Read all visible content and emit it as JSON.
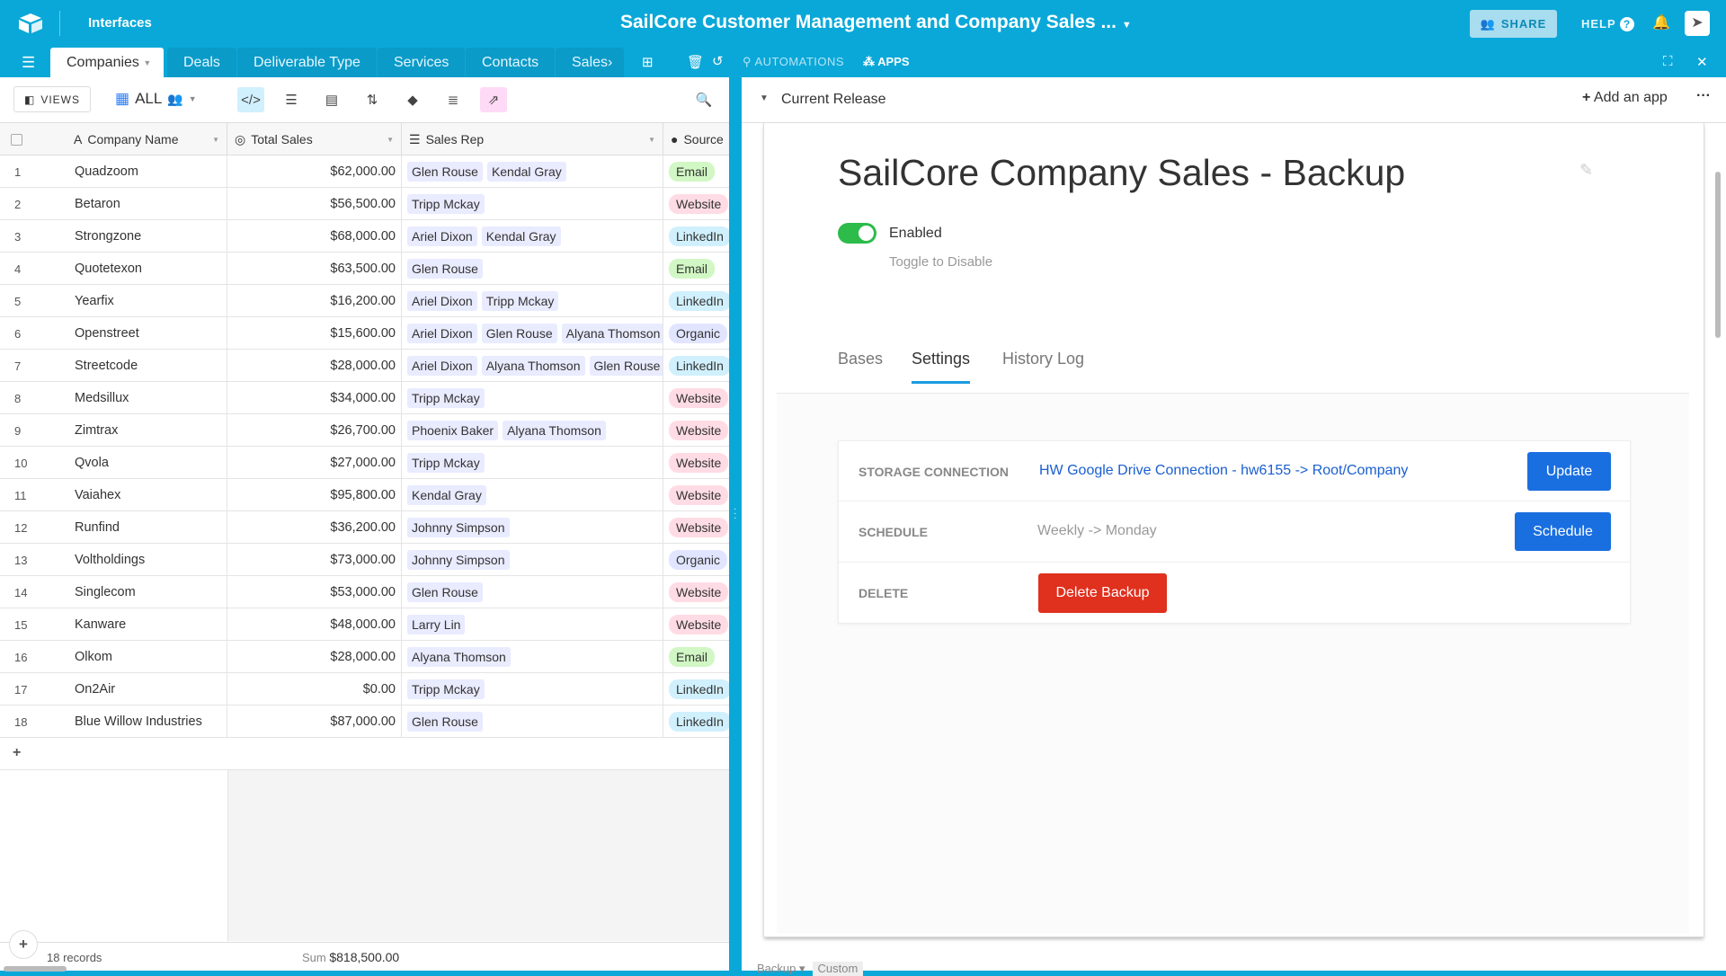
{
  "app": {
    "section": "Interfaces",
    "title": "SailCore Customer Management and Company Sales ...",
    "share": "SHARE",
    "help": "HELP"
  },
  "tabs": [
    "Companies",
    "Deals",
    "Deliverable Type",
    "Services",
    "Contacts",
    "Sales"
  ],
  "toolbar": {
    "automations": "AUTOMATIONS",
    "apps": "APPS",
    "views": "VIEWS",
    "view_name": "ALL"
  },
  "grid": {
    "columns": [
      "Company Name",
      "Total Sales",
      "Sales Rep",
      "Source"
    ],
    "rows": [
      {
        "n": "1",
        "name": "Quadzoom",
        "sales": "$62,000.00",
        "reps": [
          "Glen Rouse",
          "Kendal Gray"
        ],
        "source": "Email"
      },
      {
        "n": "2",
        "name": "Betaron",
        "sales": "$56,500.00",
        "reps": [
          "Tripp Mckay"
        ],
        "source": "Website"
      },
      {
        "n": "3",
        "name": "Strongzone",
        "sales": "$68,000.00",
        "reps": [
          "Ariel Dixon",
          "Kendal Gray"
        ],
        "source": "LinkedIn"
      },
      {
        "n": "4",
        "name": "Quotetexon",
        "sales": "$63,500.00",
        "reps": [
          "Glen Rouse"
        ],
        "source": "Email"
      },
      {
        "n": "5",
        "name": "Yearfix",
        "sales": "$16,200.00",
        "reps": [
          "Ariel Dixon",
          "Tripp Mckay"
        ],
        "source": "LinkedIn"
      },
      {
        "n": "6",
        "name": "Openstreet",
        "sales": "$15,600.00",
        "reps": [
          "Ariel Dixon",
          "Glen Rouse",
          "Alyana Thomson"
        ],
        "source": "Organic"
      },
      {
        "n": "7",
        "name": "Streetcode",
        "sales": "$28,000.00",
        "reps": [
          "Ariel Dixon",
          "Alyana Thomson",
          "Glen Rouse"
        ],
        "source": "LinkedIn"
      },
      {
        "n": "8",
        "name": "Medsillux",
        "sales": "$34,000.00",
        "reps": [
          "Tripp Mckay"
        ],
        "source": "Website"
      },
      {
        "n": "9",
        "name": "Zimtrax",
        "sales": "$26,700.00",
        "reps": [
          "Phoenix Baker",
          "Alyana Thomson"
        ],
        "source": "Website"
      },
      {
        "n": "10",
        "name": "Qvola",
        "sales": "$27,000.00",
        "reps": [
          "Tripp Mckay"
        ],
        "source": "Website"
      },
      {
        "n": "11",
        "name": "Vaiahex",
        "sales": "$95,800.00",
        "reps": [
          "Kendal Gray"
        ],
        "source": "Website"
      },
      {
        "n": "12",
        "name": "Runfind",
        "sales": "$36,200.00",
        "reps": [
          "Johnny Simpson"
        ],
        "source": "Website"
      },
      {
        "n": "13",
        "name": "Voltholdings",
        "sales": "$73,000.00",
        "reps": [
          "Johnny Simpson"
        ],
        "source": "Organic"
      },
      {
        "n": "14",
        "name": "Singlecom",
        "sales": "$53,000.00",
        "reps": [
          "Glen Rouse"
        ],
        "source": "Website"
      },
      {
        "n": "15",
        "name": "Kanware",
        "sales": "$48,000.00",
        "reps": [
          "Larry Lin"
        ],
        "source": "Website"
      },
      {
        "n": "16",
        "name": "Olkom",
        "sales": "$28,000.00",
        "reps": [
          "Alyana Thomson"
        ],
        "source": "Email"
      },
      {
        "n": "17",
        "name": "On2Air",
        "sales": "$0.00",
        "reps": [
          "Tripp Mckay"
        ],
        "source": "LinkedIn"
      },
      {
        "n": "18",
        "name": "Blue Willow Industries",
        "sales": "$87,000.00",
        "reps": [
          "Glen Rouse"
        ],
        "source": "LinkedIn"
      }
    ],
    "footer": {
      "records": "18 records",
      "sum_label": "Sum",
      "sum_value": "$818,500.00"
    }
  },
  "source_colors": {
    "Email": "#d1f7c4",
    "Website": "#ffdce5",
    "LinkedIn": "#d0f0fd",
    "Organic": "#e1e5ff"
  },
  "panel": {
    "header": "Current Release",
    "add_app": "Add an app",
    "title": "SailCore Company Sales - Backup",
    "toggle": {
      "label": "Enabled",
      "hint": "Toggle to Disable",
      "on": true
    },
    "tabs": [
      "Bases",
      "Settings",
      "History Log"
    ],
    "active_tab": "Settings",
    "settings": {
      "storage_label": "STORAGE CONNECTION",
      "storage_value": "HW Google Drive Connection - hw6155 -> Root/Company",
      "update": "Update",
      "schedule_label": "SCHEDULE",
      "schedule_value": "Weekly -> Monday",
      "schedule_btn": "Schedule",
      "delete_label": "DELETE",
      "delete_btn": "Delete Backup"
    },
    "bottom": {
      "backup": "Backup",
      "custom": "Custom"
    }
  },
  "colors": {
    "brand": "#0aa8d8",
    "primary": "#1a6fe0",
    "danger": "#e0301e",
    "toggle": "#2dbb4a"
  }
}
